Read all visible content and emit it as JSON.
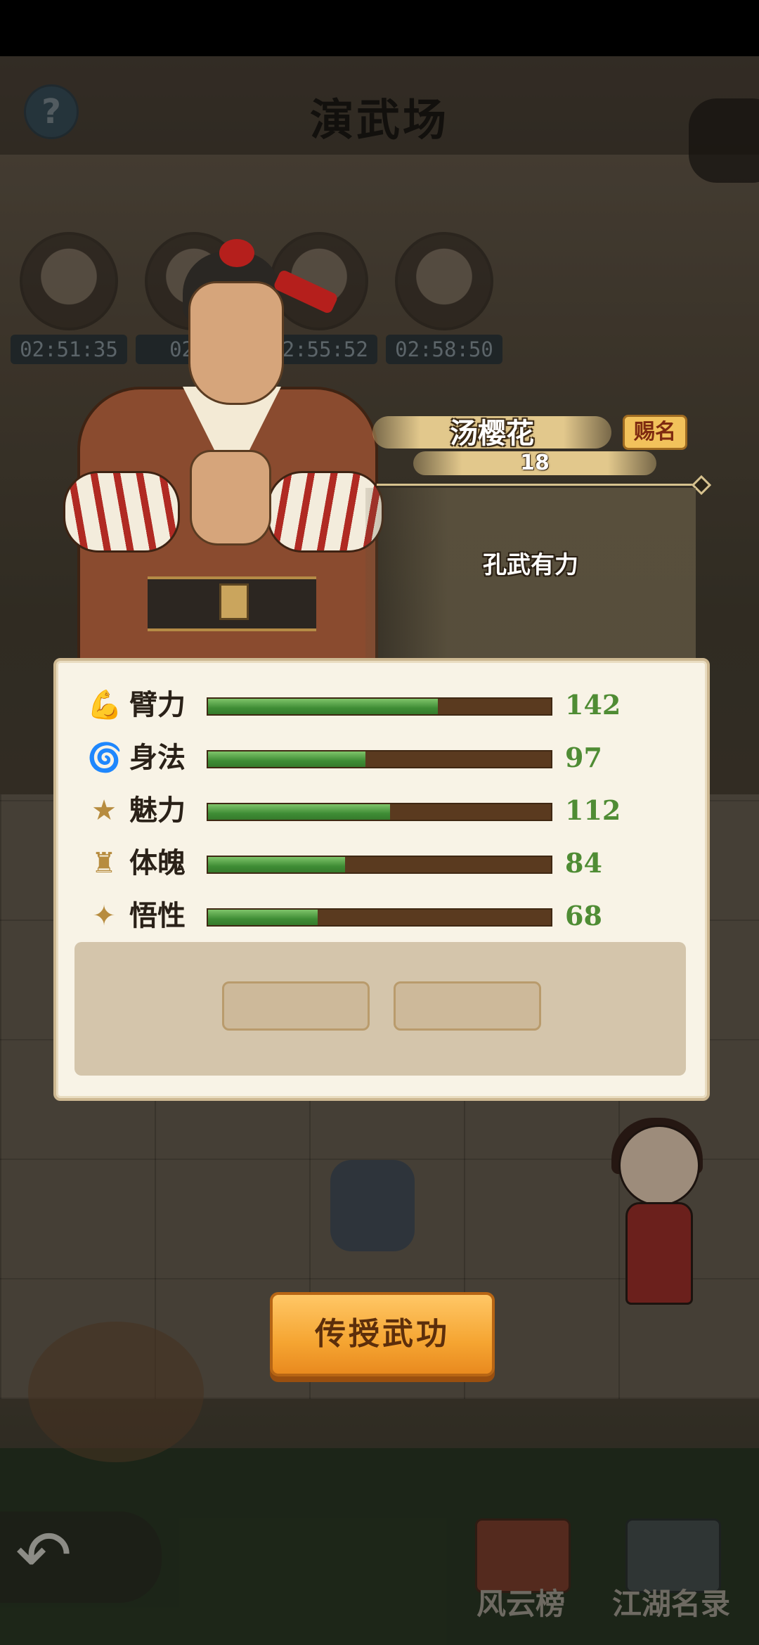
{
  "header": {
    "title": "演武场",
    "help_icon": "?"
  },
  "disciples": [
    {
      "timer": "02:51:35"
    },
    {
      "timer": "02:5"
    },
    {
      "timer": "02:55:52"
    },
    {
      "timer": "02:58:50"
    }
  ],
  "character": {
    "name": "汤樱花",
    "age": "18",
    "rename_label": "赐名",
    "description": "孔武有力"
  },
  "stats": [
    {
      "label": "臂力",
      "value": "142",
      "fill": 0.67,
      "icon": "arm-icon"
    },
    {
      "label": "身法",
      "value": "97",
      "fill": 0.46,
      "icon": "whirlwind-icon"
    },
    {
      "label": "魅力",
      "value": "112",
      "fill": 0.53,
      "icon": "star-face-icon"
    },
    {
      "label": "体魄",
      "value": "84",
      "fill": 0.4,
      "icon": "body-icon"
    },
    {
      "label": "悟性",
      "value": "68",
      "fill": 0.32,
      "icon": "sparkle-icon"
    }
  ],
  "actions": {
    "teach_label": "传授武功"
  },
  "bottom_nav": {
    "rank_label": "风云榜",
    "roster_label": "江湖名录"
  },
  "colors": {
    "bar_fill": "#4f9a3e",
    "bar_track": "#5a3a1f",
    "accent": "#f5a532",
    "value_green": "#4f8c34"
  }
}
